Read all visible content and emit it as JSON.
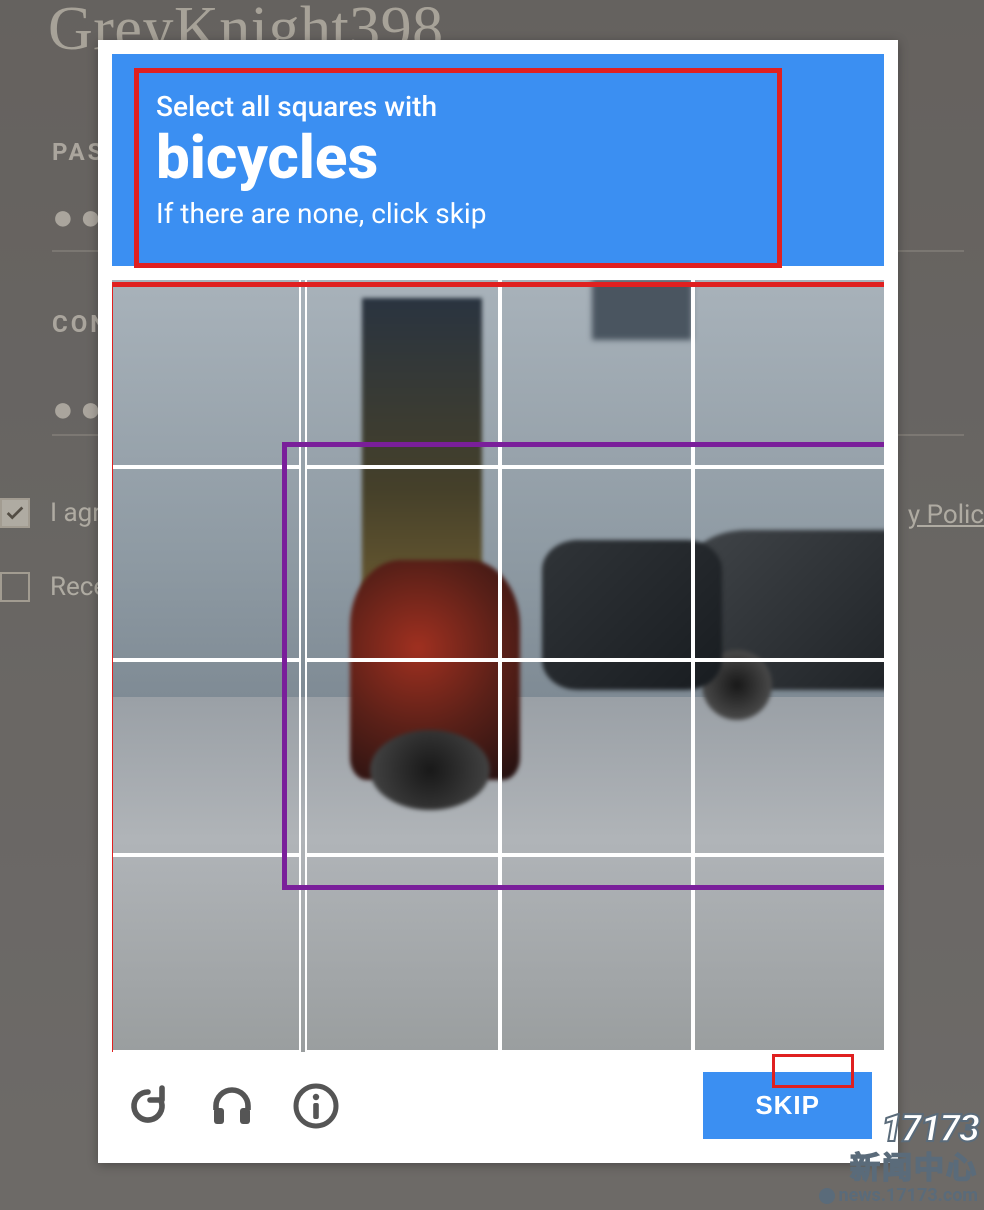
{
  "background": {
    "username": "GreyKnight398",
    "labels": {
      "pass": "PAS",
      "confirm": "CON"
    },
    "dots": "●●",
    "agree_text": "I agr",
    "receive_text": "Rece",
    "privacy_text": "y Polic"
  },
  "captcha": {
    "instruction_pre": "Select all squares with",
    "target": "bicycles",
    "instruction_post": "If there are none, click skip",
    "skip_label": "SKIP",
    "icons": {
      "reload": "reload-icon",
      "audio": "audio-icon",
      "info": "info-icon"
    },
    "grid": {
      "rows": 4,
      "cols": 4
    }
  },
  "watermark": {
    "logo": "17173",
    "cn": "新闻中心",
    "url": "news.17173.com"
  }
}
